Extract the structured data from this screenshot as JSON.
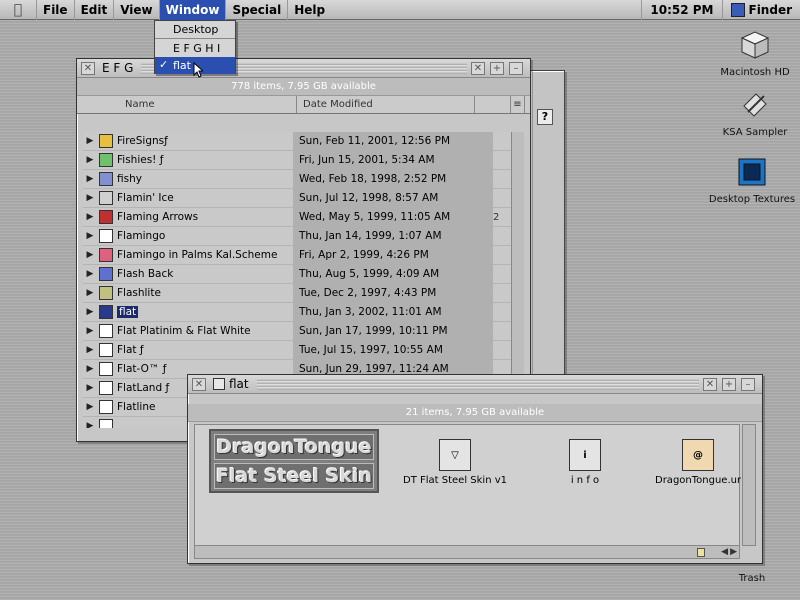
{
  "menubar": {
    "apple_icon": "apple-logo",
    "items": [
      "File",
      "Edit",
      "View",
      "Window",
      "Special",
      "Help"
    ],
    "clock": "10:52 PM",
    "app_name": "Finder"
  },
  "window_menu": {
    "items": [
      "Desktop",
      "E F G H I",
      "flat"
    ],
    "checked": "flat"
  },
  "list_window": {
    "title": "E F G",
    "info": "778 items, 7.95 GB available",
    "col_name": "Name",
    "col_date": "Date Modified",
    "rows": [
      {
        "name": "FireSignsƒ",
        "date": "Sun, Feb 11, 2001, 12:56 PM",
        "icon_color": "#e8c040"
      },
      {
        "name": "Fishies! ƒ",
        "date": "Fri, Jun 15, 2001, 5:34 AM",
        "icon_color": "#70c070"
      },
      {
        "name": "fishy",
        "date": "Wed, Feb 18, 1998, 2:52 PM",
        "icon_color": "#8090d0"
      },
      {
        "name": "Flamin' Ice",
        "date": "Sun, Jul 12, 1998, 8:57 AM",
        "icon_color": "#d0d0d0"
      },
      {
        "name": "Flaming Arrows",
        "date": "Wed, May 5, 1999, 11:05 AM",
        "icon_color": "#c03030",
        "extra": "2"
      },
      {
        "name": "Flamingo",
        "date": "Thu, Jan 14, 1999, 1:07 AM",
        "icon_color": "#ffffff"
      },
      {
        "name": "Flamingo in Palms Kal.Scheme",
        "date": "Fri, Apr 2, 1999, 4:26 PM",
        "icon_color": "#e06080"
      },
      {
        "name": "Flash Back",
        "date": "Thu, Aug 5, 1999, 4:09 AM",
        "icon_color": "#6070d0"
      },
      {
        "name": "Flashlite",
        "date": "Tue, Dec 2, 1997, 4:43 PM",
        "icon_color": "#c0c080"
      },
      {
        "name": "flat",
        "date": "Thu, Jan 3, 2002, 11:01 AM",
        "icon_color": "#2a3a8a",
        "selected": true
      },
      {
        "name": "Flat Platinim & Flat White",
        "date": "Sun, Jan 17, 1999, 10:11 PM",
        "icon_color": "#ffffff"
      },
      {
        "name": "Flat ƒ",
        "date": "Tue, Jul 15, 1997, 10:55 AM",
        "icon_color": "#ffffff"
      },
      {
        "name": "Flat-O™ ƒ",
        "date": "Sun, Jun 29, 1997, 11:24 AM",
        "icon_color": "#ffffff"
      },
      {
        "name": "FlatLand ƒ",
        "date": "",
        "icon_color": "#ffffff"
      },
      {
        "name": "Flatline",
        "date": "",
        "icon_color": "#ffffff"
      },
      {
        "name": "",
        "date": "",
        "icon_color": "#ffffff"
      }
    ]
  },
  "icon_window": {
    "title": "flat",
    "info": "21 items, 7.95 GB available",
    "logo_lines": [
      "DragonTongue",
      "Flat Steel Skin"
    ],
    "items": [
      {
        "label": "DT Flat Steel Skin v1",
        "icon": "skin-icon"
      },
      {
        "label": "i n f o",
        "icon": "info-icon"
      },
      {
        "label": "DragonTongue.ur",
        "icon": "url-icon"
      }
    ]
  },
  "desktop": {
    "icons": [
      {
        "label": "Macintosh HD",
        "icon": "hard-drive-icon"
      },
      {
        "label": "KSA Sampler",
        "icon": "sampler-icon"
      },
      {
        "label": "Desktop Textures",
        "icon": "textures-icon"
      },
      {
        "label": "Trash",
        "icon": "trash-icon"
      }
    ]
  }
}
